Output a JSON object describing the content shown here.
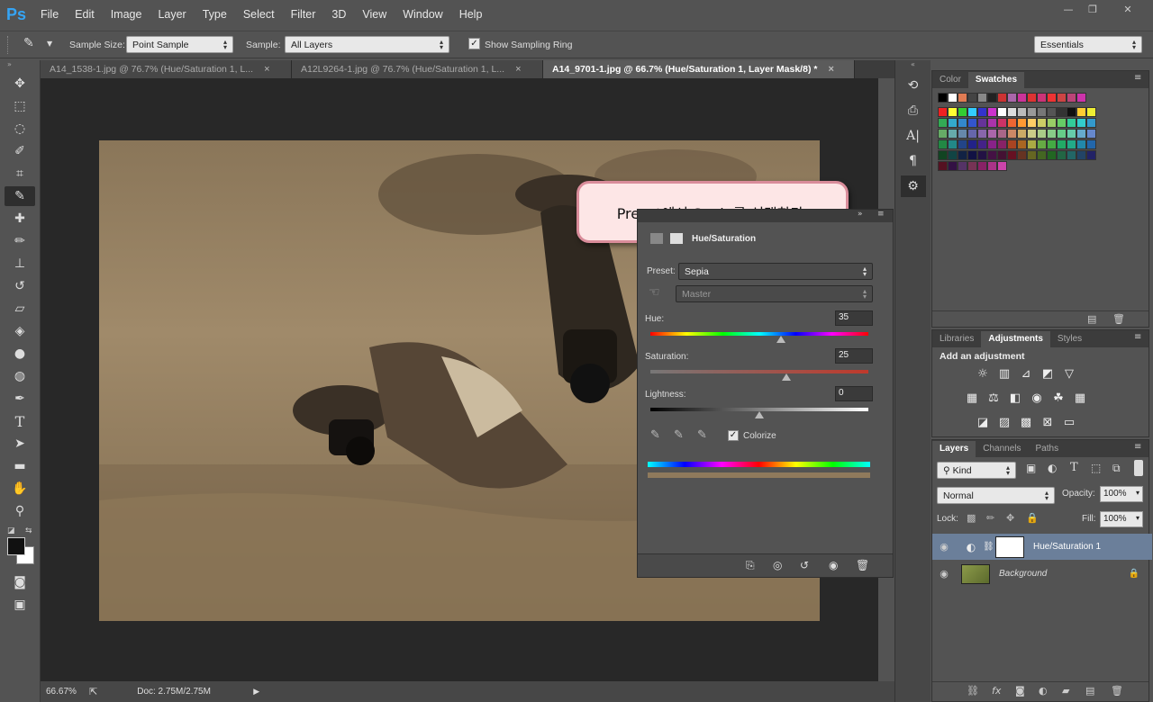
{
  "app": {
    "logo": "Ps"
  },
  "menu": [
    "File",
    "Edit",
    "Image",
    "Layer",
    "Type",
    "Select",
    "Filter",
    "3D",
    "View",
    "Window",
    "Help"
  ],
  "window_controls": {
    "minimize": "—",
    "restore": "❐",
    "close": "✕"
  },
  "options": {
    "sample_size_label": "Sample Size:",
    "sample_size_value": "Point Sample",
    "sample_label": "Sample:",
    "sample_value": "All Layers",
    "ring_label": "Show Sampling Ring",
    "workspace": "Essentials"
  },
  "tabs": [
    {
      "label": "A14_1538-1.jpg @ 76.7% (Hue/Saturation 1, L...",
      "close": "×"
    },
    {
      "label": "A12L9264-1.jpg @ 76.7% (Hue/Saturation 1, L...",
      "close": "×"
    },
    {
      "label": "A14_9701-1.jpg @ 66.7% (Hue/Saturation 1, Layer Mask/8) *",
      "close": "×"
    }
  ],
  "status": {
    "zoom": "66.67%",
    "doc": "Doc: 2.75M/2.75M"
  },
  "callout": "Preset에서 Sepia를 선택한다.",
  "properties": {
    "title": "Hue/Saturation",
    "preset_label": "Preset:",
    "preset_value": "Sepia",
    "channel_value": "Master",
    "hue_label": "Hue:",
    "hue_value": "35",
    "saturation_label": "Saturation:",
    "saturation_value": "25",
    "lightness_label": "Lightness:",
    "lightness_value": "0",
    "colorize_label": "Colorize",
    "hue_level": 0.6,
    "saturation_level": 0.625,
    "lightness_level": 0.5
  },
  "color_panel": {
    "tab_color": "Color",
    "tab_swatches": "Swatches"
  },
  "adjustments_panel": {
    "tab_libraries": "Libraries",
    "tab_adjustments": "Adjustments",
    "tab_styles": "Styles",
    "heading": "Add an adjustment"
  },
  "layers_panel": {
    "tab_layers": "Layers",
    "tab_channels": "Channels",
    "tab_paths": "Paths",
    "kind": "Kind",
    "blend_mode": "Normal",
    "opacity_label": "Opacity:",
    "opacity_value": "100%",
    "lock_label": "Lock:",
    "fill_label": "Fill:",
    "fill_value": "100%",
    "layers": [
      {
        "name": "Hue/Saturation 1"
      },
      {
        "name": "Background"
      }
    ]
  },
  "colors": {
    "accent": "#35a4f4",
    "callout_border": "#d98c9a",
    "callout_bg": "#fde6e6",
    "sepia": "#8f7a5c"
  }
}
